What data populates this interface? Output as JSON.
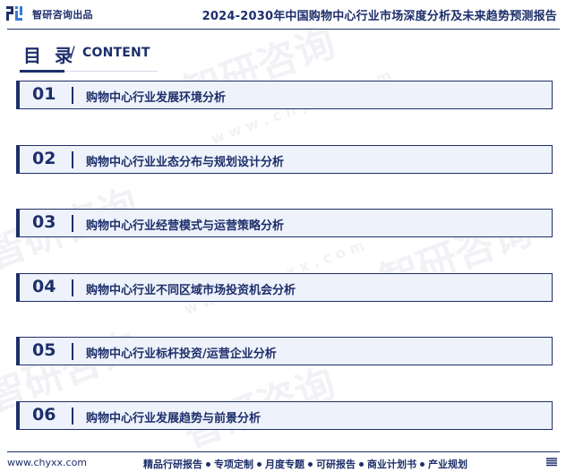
{
  "header": {
    "brand": "智研咨询出品",
    "report_title": "2024-2030年中国购物中心行业市场深度分析及未来趋势预测报告"
  },
  "toc": {
    "title": "目 录",
    "subtitle": "CONTENT",
    "items": [
      {
        "num": "01",
        "label": "购物中心行业发展环境分析"
      },
      {
        "num": "02",
        "label": "购物中心行业业态分布与规划设计分析"
      },
      {
        "num": "03",
        "label": "购物中心行业经营模式与运营策略分析"
      },
      {
        "num": "04",
        "label": "购物中心行业不同区域市场投资机会分析"
      },
      {
        "num": "05",
        "label": "购物中心行业标杆投资/运营企业分析"
      },
      {
        "num": "06",
        "label": "购物中心行业发展趋势与前景分析"
      }
    ]
  },
  "footer": {
    "url": "www.chyxx.com",
    "links": [
      "精品行研报告",
      "专项定制",
      "月度专题",
      "可研报告",
      "商业计划书",
      "产业规划"
    ],
    "icon": "stack-lines-icon"
  },
  "watermark": {
    "text": "智研咨询",
    "url": "w w w . c h y x x . c o m"
  },
  "colors": {
    "primary": "#1d2f6b",
    "item_bg": "#eef2fa"
  }
}
